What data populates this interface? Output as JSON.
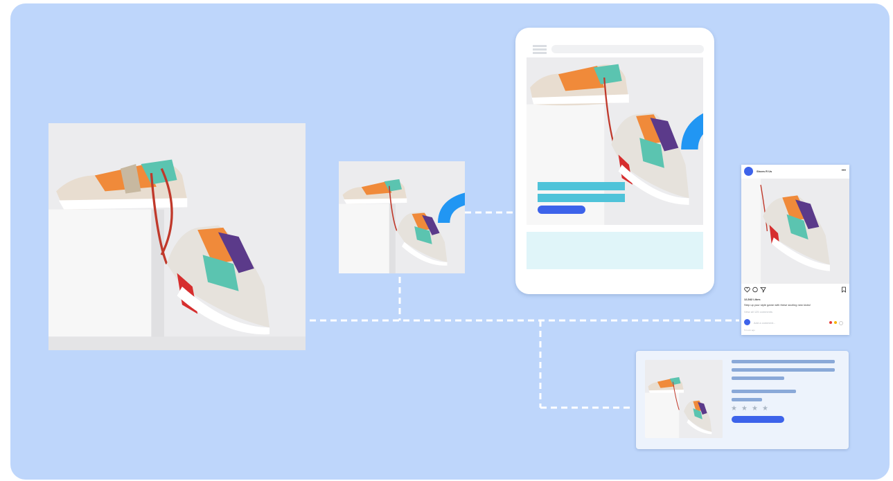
{
  "post": {
    "account": "Shoes R Us",
    "more": "•••",
    "likes": "12,542 Likes",
    "caption": "Step up your style game with these sizzling new kicks!",
    "comments_link": "View all 125 comments",
    "comment_placeholder": "Add a comment...",
    "time": "5 hours ago"
  },
  "review_card": {
    "stars": [
      "★",
      "★",
      "★",
      "★"
    ]
  },
  "colors": {
    "background": "#bed6fb",
    "accent_blue": "#2196f3",
    "button_blue": "#3d63ea",
    "teal_bar": "#4fc3d9",
    "text_line": "#8aa9d8",
    "dashed_line": "#ffffff"
  },
  "icons": {
    "upload": "cloud-upload-icon",
    "camera": "camera-icon",
    "rotate": "rotate-icon",
    "menu": "hamburger-menu-icon",
    "like": "heart-outline-icon",
    "comment": "comment-icon",
    "share": "send-icon",
    "save": "bookmark-icon"
  }
}
